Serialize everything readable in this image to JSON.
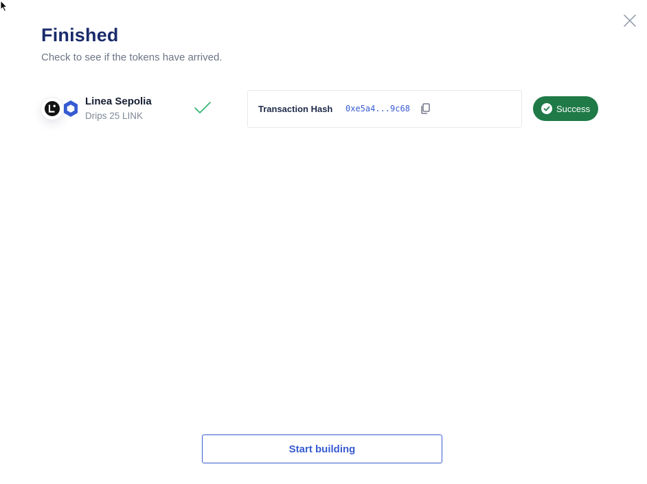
{
  "dialog": {
    "title": "Finished",
    "subtitle": "Check to see if the tokens have arrived."
  },
  "network": {
    "name": "Linea Sepolia",
    "drip": "Drips 25 LINK",
    "icons": [
      "linea-logo-icon",
      "chainlink-logo-icon",
      "check-icon"
    ]
  },
  "transaction": {
    "label": "Transaction Hash",
    "hash": "0xe5a4...9c68",
    "copy_icon": "copy-icon"
  },
  "status": {
    "label": "Success",
    "color": "#1f7a47"
  },
  "footer": {
    "button_label": "Start building"
  },
  "colors": {
    "title": "#1a2b6b",
    "accent": "#375bd2",
    "check": "#2db36f"
  }
}
